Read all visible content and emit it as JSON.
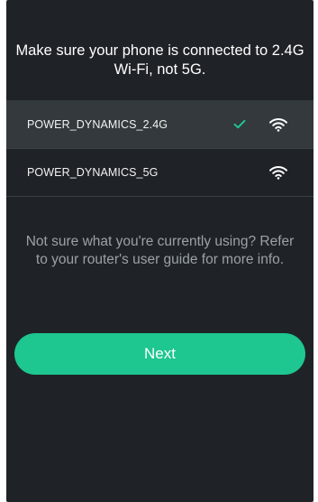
{
  "instruction": "Make sure your phone is connected to 2.4G Wi-Fi, not 5G.",
  "networks": [
    {
      "ssid": "POWER_DYNAMICS_2.4G",
      "selected": true,
      "icon": "wifi-icon"
    },
    {
      "ssid": "POWER_DYNAMICS_5G",
      "selected": false,
      "icon": "wifi-icon"
    }
  ],
  "help_text": "Not sure what you're currently using? Refer to your router's user guide for more info.",
  "next_button": {
    "label": "Next"
  },
  "colors": {
    "background": "#1f2327",
    "selected_row": "#33393d",
    "accent": "#1dc78f",
    "check": "#1dc78f",
    "help_text": "#9ba1a5"
  }
}
